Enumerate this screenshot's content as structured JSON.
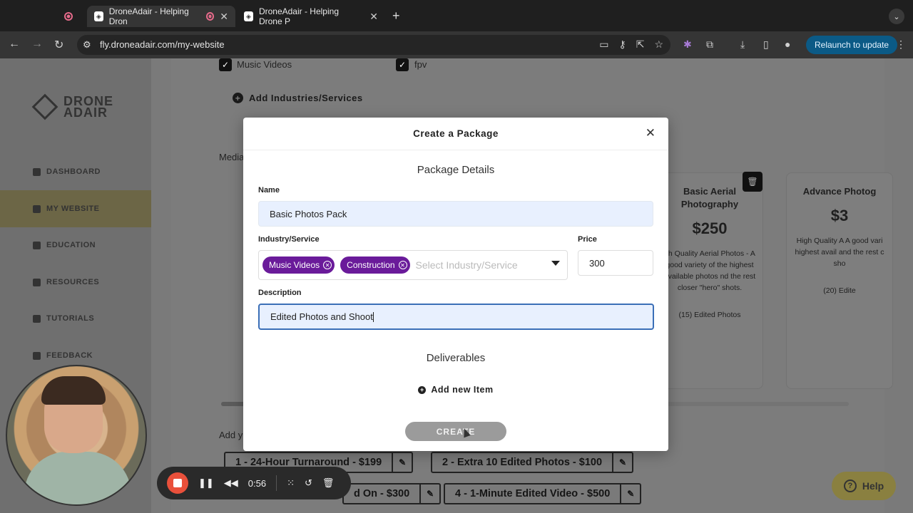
{
  "browser": {
    "tabs": [
      {
        "title": ""
      },
      {
        "title": "DroneAdair - Helping Dron"
      },
      {
        "title": "DroneAdair - Helping Drone P"
      }
    ],
    "url": "fly.droneadair.com/my-website",
    "relaunch_label": "Relaunch to update"
  },
  "sidebar": {
    "logo_line1": "DRONE",
    "logo_line2": "ADAIR",
    "items": [
      {
        "label": "DASHBOARD"
      },
      {
        "label": "MY WEBSITE"
      },
      {
        "label": "EDUCATION"
      },
      {
        "label": "RESOURCES"
      },
      {
        "label": "TUTORIALS"
      },
      {
        "label": "FEEDBACK"
      }
    ]
  },
  "background": {
    "checkbox_music": "Music Videos",
    "checkbox_fpv": "fpv",
    "add_industries": "Add Industries/Services",
    "media_partial": "Media",
    "add_partial": "Add y",
    "cards": [
      {
        "title": "Basic Aerial Photography",
        "price": "$250",
        "desc": "gh Quality Aerial Photos - A good variety of the highest available photos nd the rest closer \"hero\" shots.",
        "item": "(15) Edited Photos"
      },
      {
        "title": "Advance Photog",
        "price": "$3",
        "desc": "High Quality A A good vari highest avail and the rest c sho",
        "item": "(20) Edite"
      }
    ],
    "addons": [
      {
        "label": "1 - 24-Hour Turnaround - $199"
      },
      {
        "label": "2 - Extra 10 Edited Photos - $100"
      },
      {
        "label": "d On - $300"
      },
      {
        "label": "4 - 1-Minute Edited Video - $500"
      }
    ]
  },
  "modal": {
    "title": "Create a Package",
    "section_details": "Package Details",
    "name_label": "Name",
    "name_value": "Basic Photos Pack",
    "industry_label": "Industry/Service",
    "chips": [
      {
        "label": "Music Videos"
      },
      {
        "label": "Construction"
      }
    ],
    "industry_placeholder": "Select Industry/Service",
    "price_label": "Price",
    "price_value": "300",
    "description_label": "Description",
    "description_value": "Edited Photos and Shoot",
    "section_deliverables": "Deliverables",
    "add_item_label": "Add new Item",
    "create_label": "CREATE"
  },
  "help_label": "Help",
  "recorder": {
    "time": "0:56"
  },
  "colors": {
    "accent_chip": "#6a1b9a",
    "relaunch": "#0b5a86",
    "record": "#e9503b"
  }
}
